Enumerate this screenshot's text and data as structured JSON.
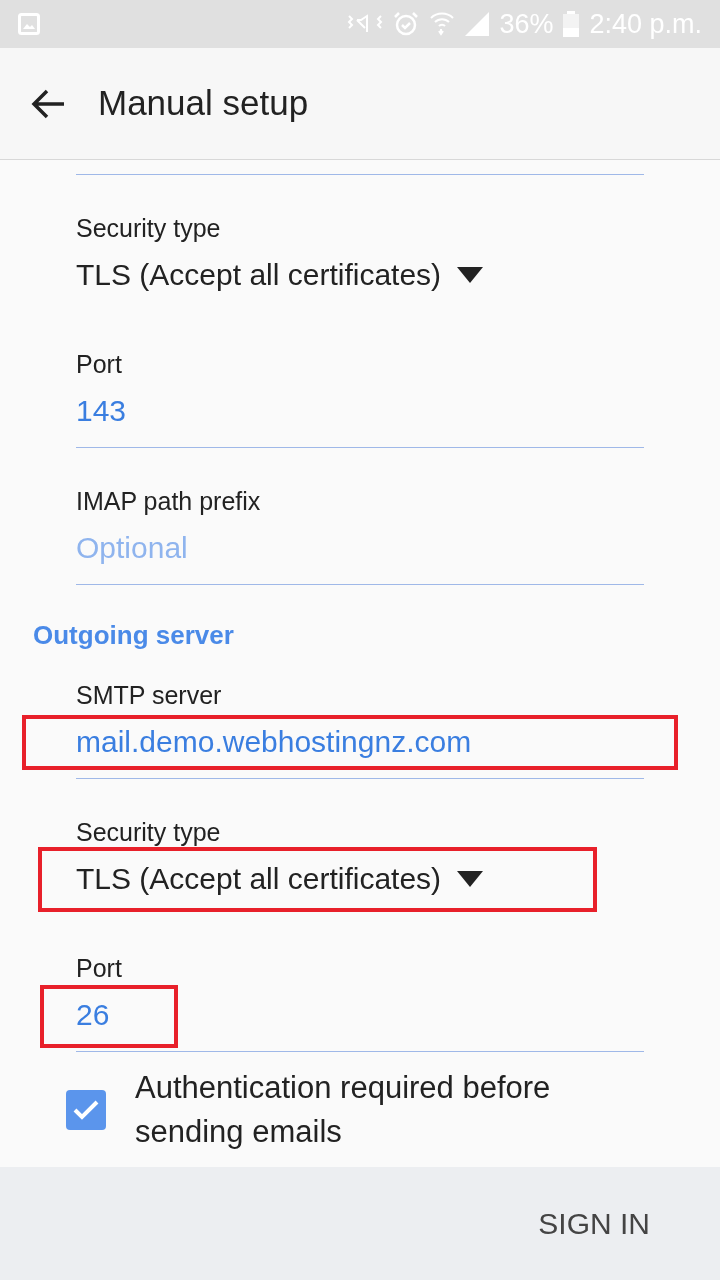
{
  "status_bar": {
    "battery": "36%",
    "time": "2:40 p.m."
  },
  "app_bar": {
    "title": "Manual setup"
  },
  "incoming": [
    {
      "kind": "dropdown",
      "label": "Security type",
      "value": "TLS (Accept all certificates)",
      "highlighted": false
    },
    {
      "kind": "number",
      "label": "Port",
      "value": "143",
      "highlighted": false
    },
    {
      "kind": "text",
      "label": "IMAP path prefix",
      "placeholder": "Optional",
      "highlighted": false
    }
  ],
  "outgoing": {
    "heading": "Outgoing server",
    "fields": [
      {
        "kind": "text",
        "label": "SMTP server",
        "value": "mail.demo.webhostingnz.com",
        "highlighted": true
      },
      {
        "kind": "dropdown",
        "label": "Security type",
        "value": "TLS (Accept all certificates)",
        "highlighted": true
      },
      {
        "kind": "number",
        "label": "Port",
        "value": "26",
        "highlighted": true
      }
    ]
  },
  "authentication": {
    "label": "Authentication required before sending emails",
    "checked": true
  },
  "footer": {
    "button": "SIGN IN"
  }
}
